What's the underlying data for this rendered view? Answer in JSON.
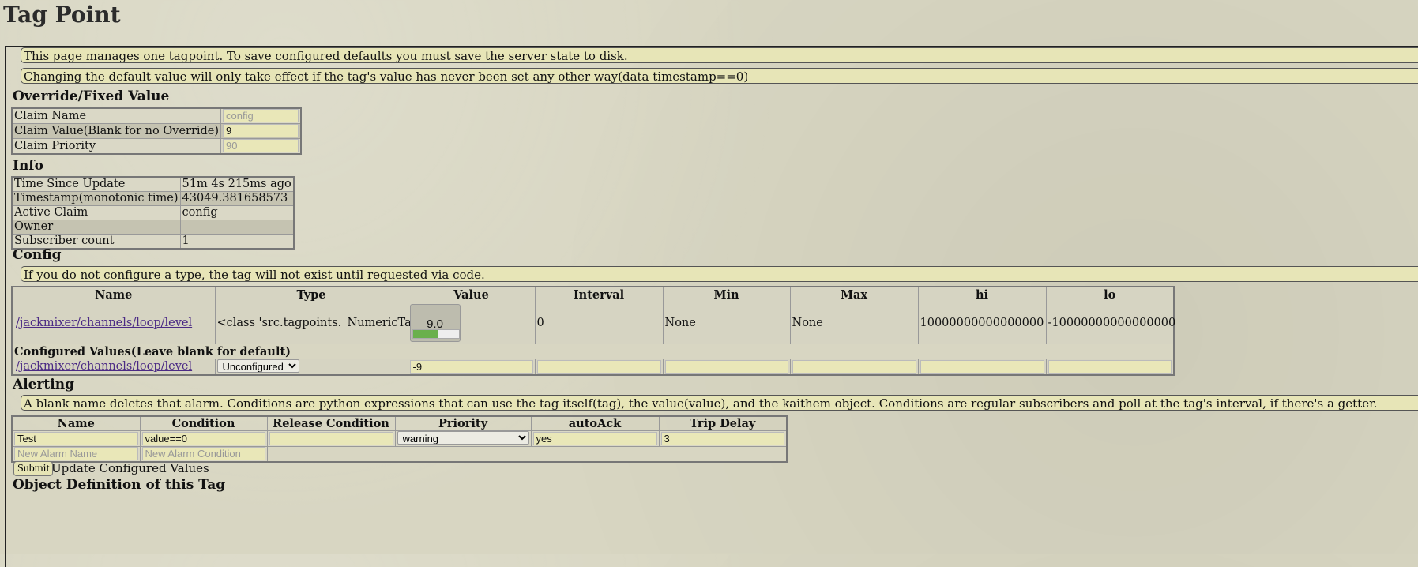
{
  "page_title": "Tag Point",
  "notices": {
    "save_info": "This page manages one tagpoint. To save configured defaults you must save the server state to disk.",
    "default_info": "Changing the default value will only take effect if the tag's value has never been set any other way(data timestamp==0)",
    "type_info": "If you do not configure a type, the tag will not exist until requested via code.",
    "alert_info": "A blank name deletes that alarm. Conditions are python expressions that can use the tag itself(tag), the value(value), and the kaithem object. Conditions are regular subscribers and poll at the tag's interval, if there's a getter."
  },
  "override": {
    "heading": "Override/Fixed Value",
    "rows": [
      {
        "label": "Claim Name",
        "value": "",
        "placeholder": "config"
      },
      {
        "label": "Claim Value(Blank for no Override)",
        "value": "9",
        "placeholder": ""
      },
      {
        "label": "Claim Priority",
        "value": "",
        "placeholder": "90"
      }
    ]
  },
  "info": {
    "heading": "Info",
    "rows": [
      {
        "label": "Time Since Update",
        "value": "51m 4s 215ms ago"
      },
      {
        "label": "Timestamp(monotonic time)",
        "value": "43049.381658573"
      },
      {
        "label": "Active Claim",
        "value": "config"
      },
      {
        "label": "Owner",
        "value": ""
      },
      {
        "label": "Subscriber count",
        "value": "1"
      }
    ]
  },
  "config": {
    "heading": "Config",
    "columns": [
      "Name",
      "Type",
      "Value",
      "Interval",
      "Min",
      "Max",
      "hi",
      "lo"
    ],
    "row": {
      "name": "/jackmixer/channels/loop/level",
      "type": "<class 'src.tagpoints._NumericTagPoint'>",
      "value": "9.0",
      "meter_fraction": 0.55,
      "interval": "0",
      "min": "None",
      "max": "None",
      "hi": "10000000000000000",
      "lo": "-10000000000000000"
    },
    "configured_heading": "Configured Values(Leave blank for default)",
    "configured": {
      "name": "/jackmixer/channels/loop/level",
      "type_select": "Unconfigured",
      "value": "-9"
    }
  },
  "alerting": {
    "heading": "Alerting",
    "columns": [
      "Name",
      "Condition",
      "Release Condition",
      "Priority",
      "autoAck",
      "Trip Delay"
    ],
    "alarm": {
      "name": "Test",
      "condition": "value==0",
      "release": "",
      "priority": "warning",
      "autoack": "yes",
      "trip_delay": "3"
    },
    "new_name_placeholder": "New Alarm Name",
    "new_condition_placeholder": "New Alarm Condition"
  },
  "submit": {
    "button": "Submit",
    "label": "Update Configured Values"
  },
  "next_heading": "Object Definition of this Tag"
}
